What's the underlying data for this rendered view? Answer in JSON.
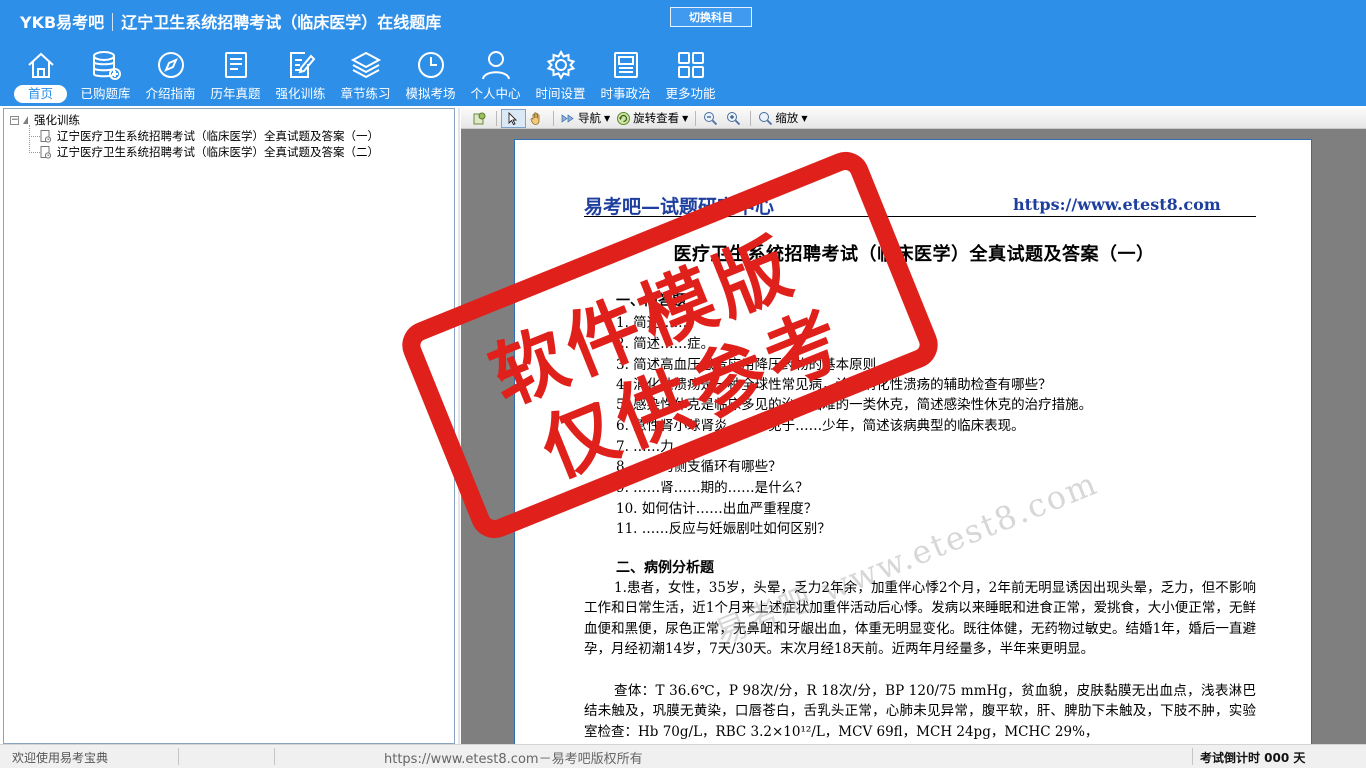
{
  "app": {
    "brand": "YKB易考吧",
    "title": "辽宁卫生系统招聘考试（临床医学）在线题库",
    "switch_label": "切换科目"
  },
  "nav": [
    {
      "label": "首页",
      "icon": "home-icon"
    },
    {
      "label": "已购题库",
      "icon": "database-icon"
    },
    {
      "label": "介绍指南",
      "icon": "compass-icon"
    },
    {
      "label": "历年真题",
      "icon": "list-document-icon"
    },
    {
      "label": "强化训练",
      "icon": "edit-icon"
    },
    {
      "label": "章节练习",
      "icon": "layers-icon"
    },
    {
      "label": "模拟考场",
      "icon": "clock-icon"
    },
    {
      "label": "个人中心",
      "icon": "user-icon"
    },
    {
      "label": "时间设置",
      "icon": "gear-icon"
    },
    {
      "label": "时事政治",
      "icon": "newspaper-icon"
    },
    {
      "label": "更多功能",
      "icon": "grid-icon"
    }
  ],
  "tree": {
    "root": "强化训练",
    "children": [
      "辽宁医疗卫生系统招聘考试（临床医学）全真试题及答案（一）",
      "辽宁医疗卫生系统招聘考试（临床医学）全真试题及答案（二）"
    ]
  },
  "toolbar": {
    "nav_label": "导航",
    "rotate_label": "旋转查看",
    "zoom_label": "缩放"
  },
  "document": {
    "header_left": "易考吧—试题研究中心",
    "header_right": "https://www.etest8.com",
    "title": "医疗卫生系统招聘考试（临床医学）全真试题及答案（一）",
    "section1": "一、简答题",
    "questions": [
      "1. 简述……",
      "2. 简述……症。",
      "3. 简述高血压患者应用降压药物的基本原则。",
      "4. 消化性溃疡是一种全球性常见病，诊断消化性溃疡的辅助检查有哪些？",
      "5. 感染性休克是临床多见的治疗困难的一类休克，简述感染性休克的治疗措施。",
      "6. 急性肾小球肾炎……多见于……少年，简述该病典型的临床表现。",
      "7. ……力……",
      "8. ……的侧支循环有哪些？",
      "9. ……肾……期的……是什么？",
      "10. 如何估计……出血严重程度？",
      "11. ……反应与妊娠剧吐如何区别？"
    ],
    "section2": "二、病例分析题",
    "case_para1": "1.患者，女性，35岁，头晕，乏力2年余，加重伴心悸2个月，2年前无明显诱因出现头晕，乏力，但不影响工作和日常生活，近1个月来上述症状加重伴活动后心悸。发病以来睡眠和进食正常，爱挑食，大小便正常，无鲜血便和黑便，尿色正常，无鼻衄和牙龈出血，体重无明显变化。既往体健，无药物过敏史。结婚1年，婚后一直避孕，月经初潮14岁，7天/30天。末次月经18天前。近两年月经量多，半年来更明显。",
    "case_para2": "查体：T 36.6℃，P 98次/分，R 18次/分，BP 120/75 mmHg，贫血貌，皮肤黏膜无出血点，浅表淋巴结未触及，巩膜无黄染，口唇苍白，舌乳头正常，心肺未见异常，腹平软，肝、脾肋下未触及，下肢不肿，实验室检查：Hb 70g/L，RBC 3.2×10¹²/L，MCV 69fl，MCH 24pg，MCHC 29%，"
  },
  "watermark": {
    "stamp_line1": "软件模版",
    "stamp_line2": "仅供参考",
    "diagonal": "易考吧 www.etest8.com"
  },
  "status": {
    "left": "欢迎使用易考宝典",
    "center": "https://www.etest8.com－易考吧版权所有",
    "right": "考试倒计时 000 天"
  },
  "colors": {
    "header_bg": "#2e8fe8",
    "stamp_red": "#e0201b",
    "doc_header_blue": "#1e3f9e"
  }
}
